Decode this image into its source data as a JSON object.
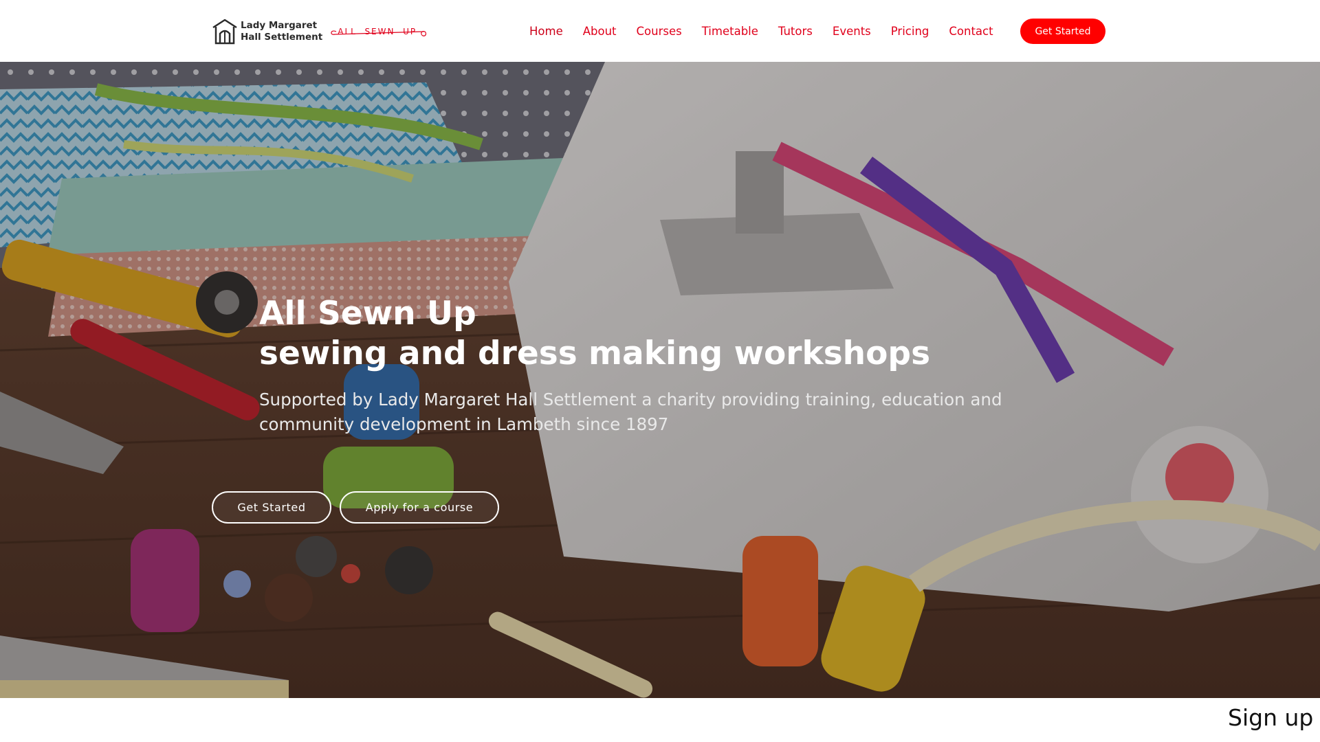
{
  "logo": {
    "line1": "Lady Margaret",
    "line2": "Hall Settlement",
    "sub": "ALL  SEWN  UP"
  },
  "nav": {
    "items": [
      "Home",
      "About",
      "Courses",
      "Timetable",
      "Tutors",
      "Events",
      "Pricing",
      "Contact"
    ],
    "cta": "Get Started"
  },
  "hero": {
    "title_line1": "All Sewn Up",
    "title_line2": "sewing and dress making workshops",
    "subtitle": "Supported by Lady Margaret Hall Settlement a charity providing training, education and community development in Lambeth since 1897",
    "button1": "Get Started",
    "button2": "Apply for a course"
  },
  "footer_peek": {
    "text": "Sign up n"
  },
  "colors": {
    "accent": "#e0001b",
    "cta_bg": "#ff0000",
    "hero_text": "#ffffff"
  }
}
